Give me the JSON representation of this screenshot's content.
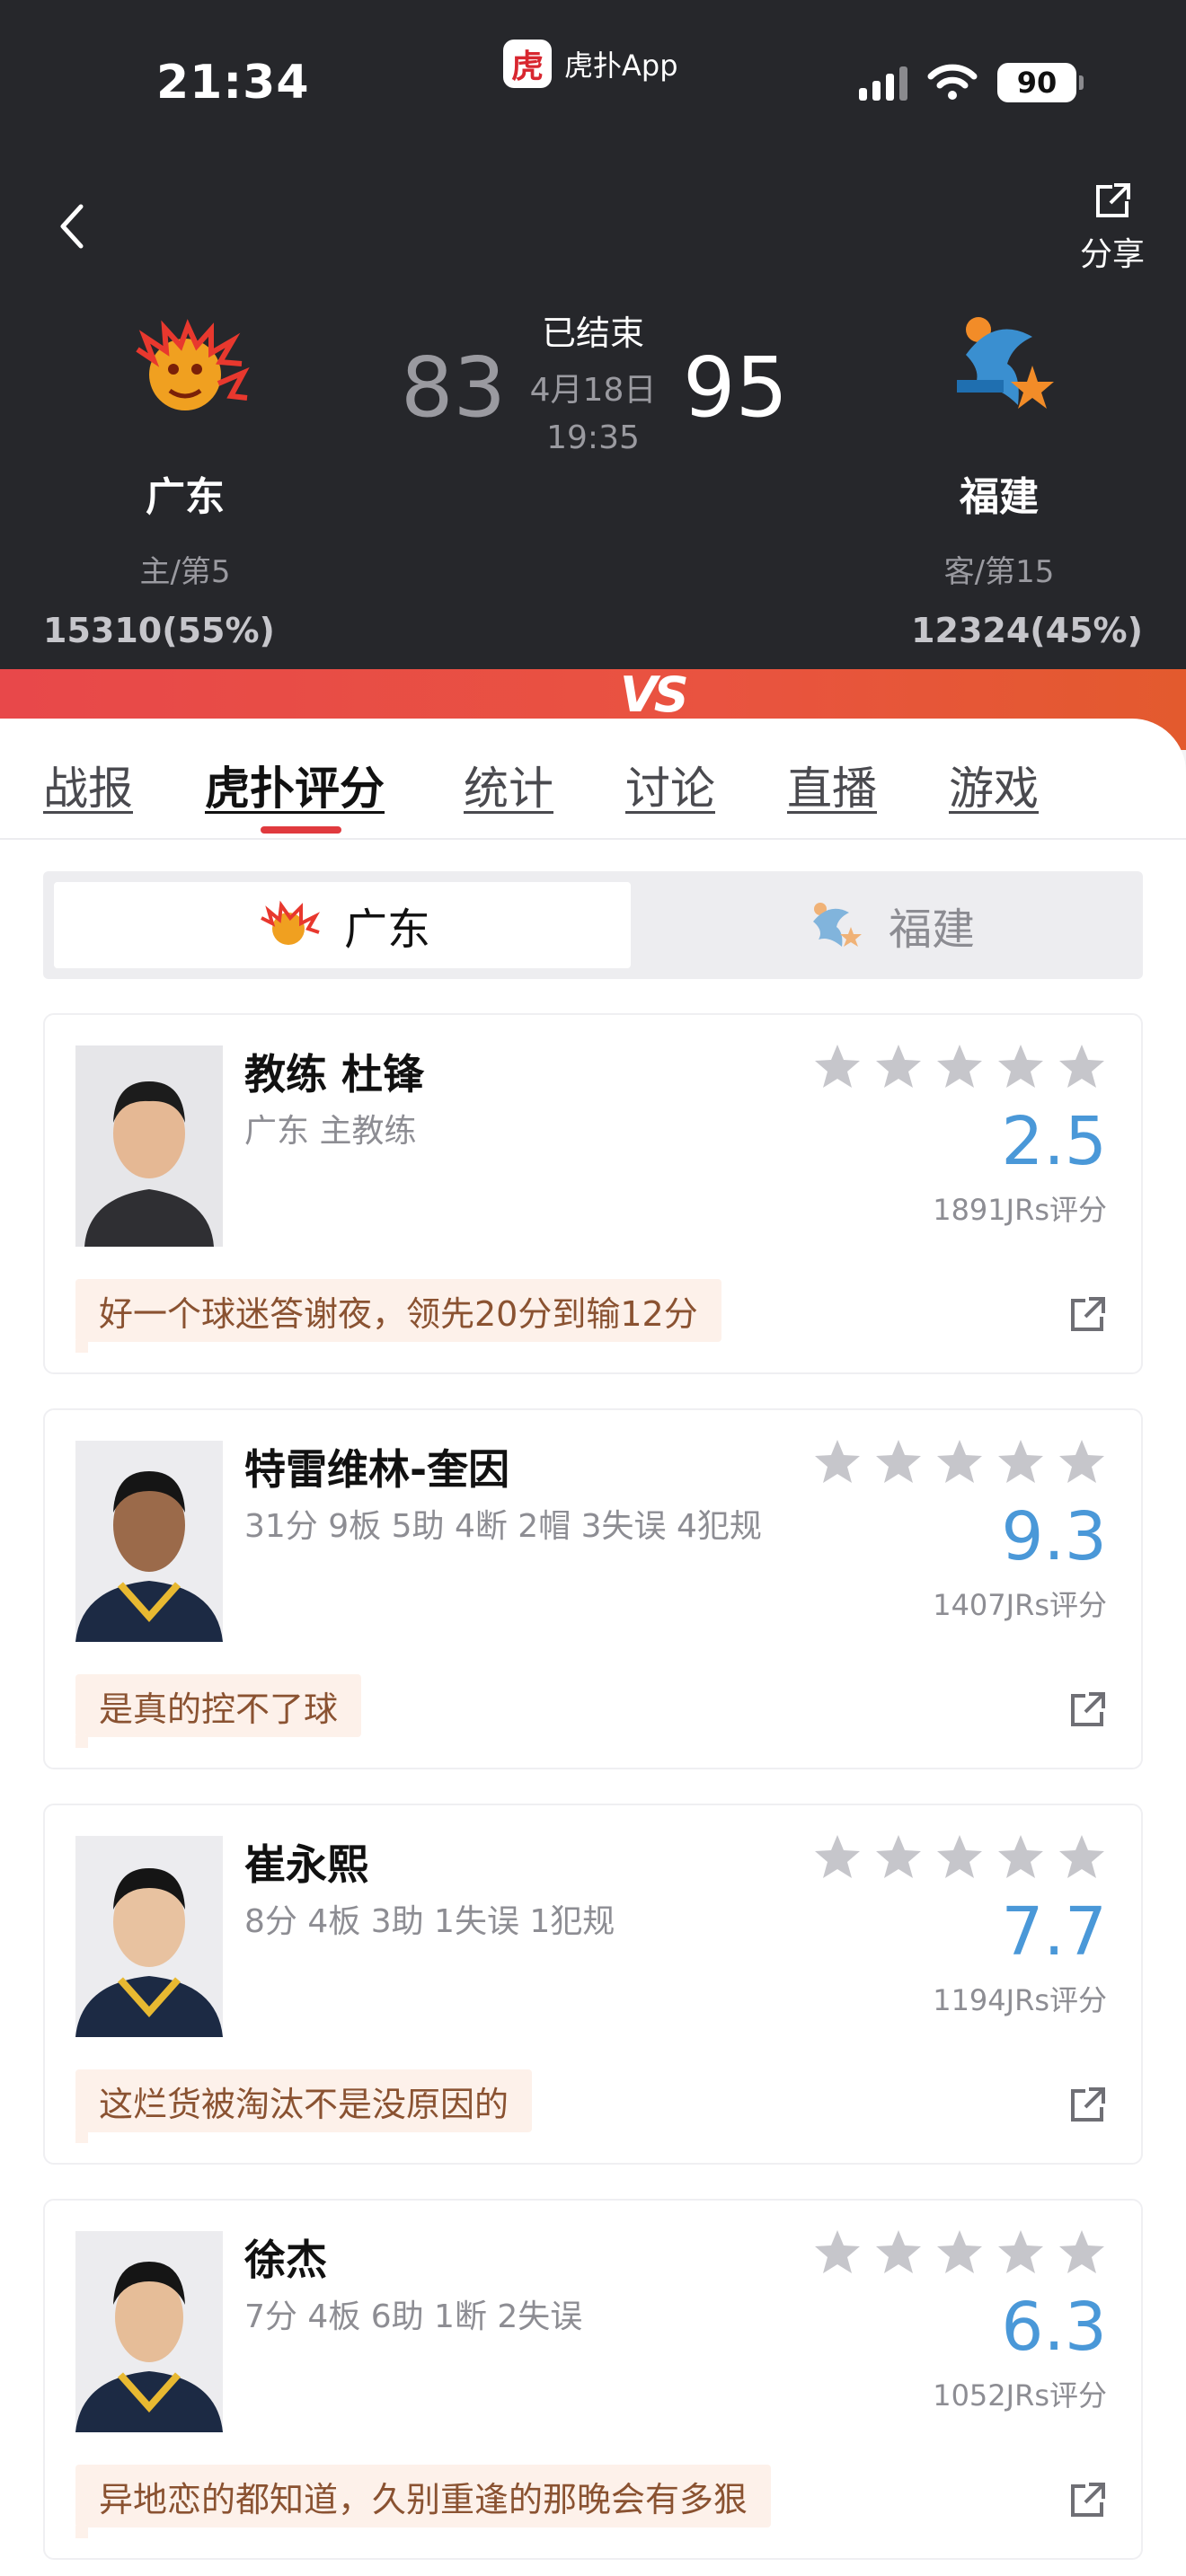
{
  "status_bar": {
    "time": "21:34",
    "app_badge": "虎扑App",
    "battery": "90"
  },
  "header": {
    "share_label": "分享"
  },
  "match": {
    "status": "已结束",
    "date": "4月18日",
    "time": "19:35",
    "home": {
      "name": "广东",
      "rank": "主/第5",
      "score": "83",
      "support": "15310(55%)"
    },
    "away": {
      "name": "福建",
      "rank": "客/第15",
      "score": "95",
      "support": "12324(45%)"
    }
  },
  "tabs": [
    {
      "label": "战报"
    },
    {
      "label": "虎扑评分"
    },
    {
      "label": "统计"
    },
    {
      "label": "讨论"
    },
    {
      "label": "直播"
    },
    {
      "label": "游戏"
    }
  ],
  "team_toggle": {
    "home": "广东",
    "away": "福建"
  },
  "players": [
    {
      "name": "教练 杜锋",
      "info": "广东 主教练",
      "rating": "2.5",
      "count": "1891JRs评分",
      "comment": "好一个球迷答谢夜，领先20分到输12分"
    },
    {
      "name": "特雷维林-奎因",
      "info": "31分 9板 5助 4断 2帽 3失误 4犯规",
      "rating": "9.3",
      "count": "1407JRs评分",
      "comment": "是真的控不了球"
    },
    {
      "name": "崔永熙",
      "info": "8分 4板 3助 1失误 1犯规",
      "rating": "7.7",
      "count": "1194JRs评分",
      "comment": "这烂货被淘汰不是没原因的"
    },
    {
      "name": "徐杰",
      "info": "7分 4板 6助 1断 2失误",
      "rating": "6.3",
      "count": "1052JRs评分",
      "comment": "异地恋的都知道，久别重逢的那晚会有多狠"
    }
  ],
  "colors": {
    "accent_red": "#e03a3e",
    "rating_blue": "#4a98d8",
    "header_bg": "#26272b"
  }
}
